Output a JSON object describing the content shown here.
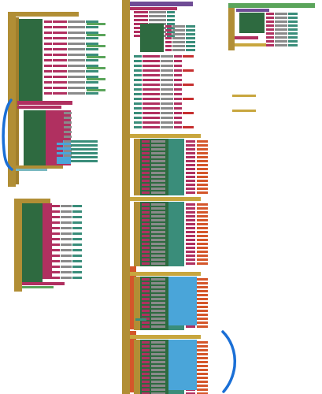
{
  "workspace": {
    "title": "",
    "annotation_color": "#1a6fd6"
  }
}
